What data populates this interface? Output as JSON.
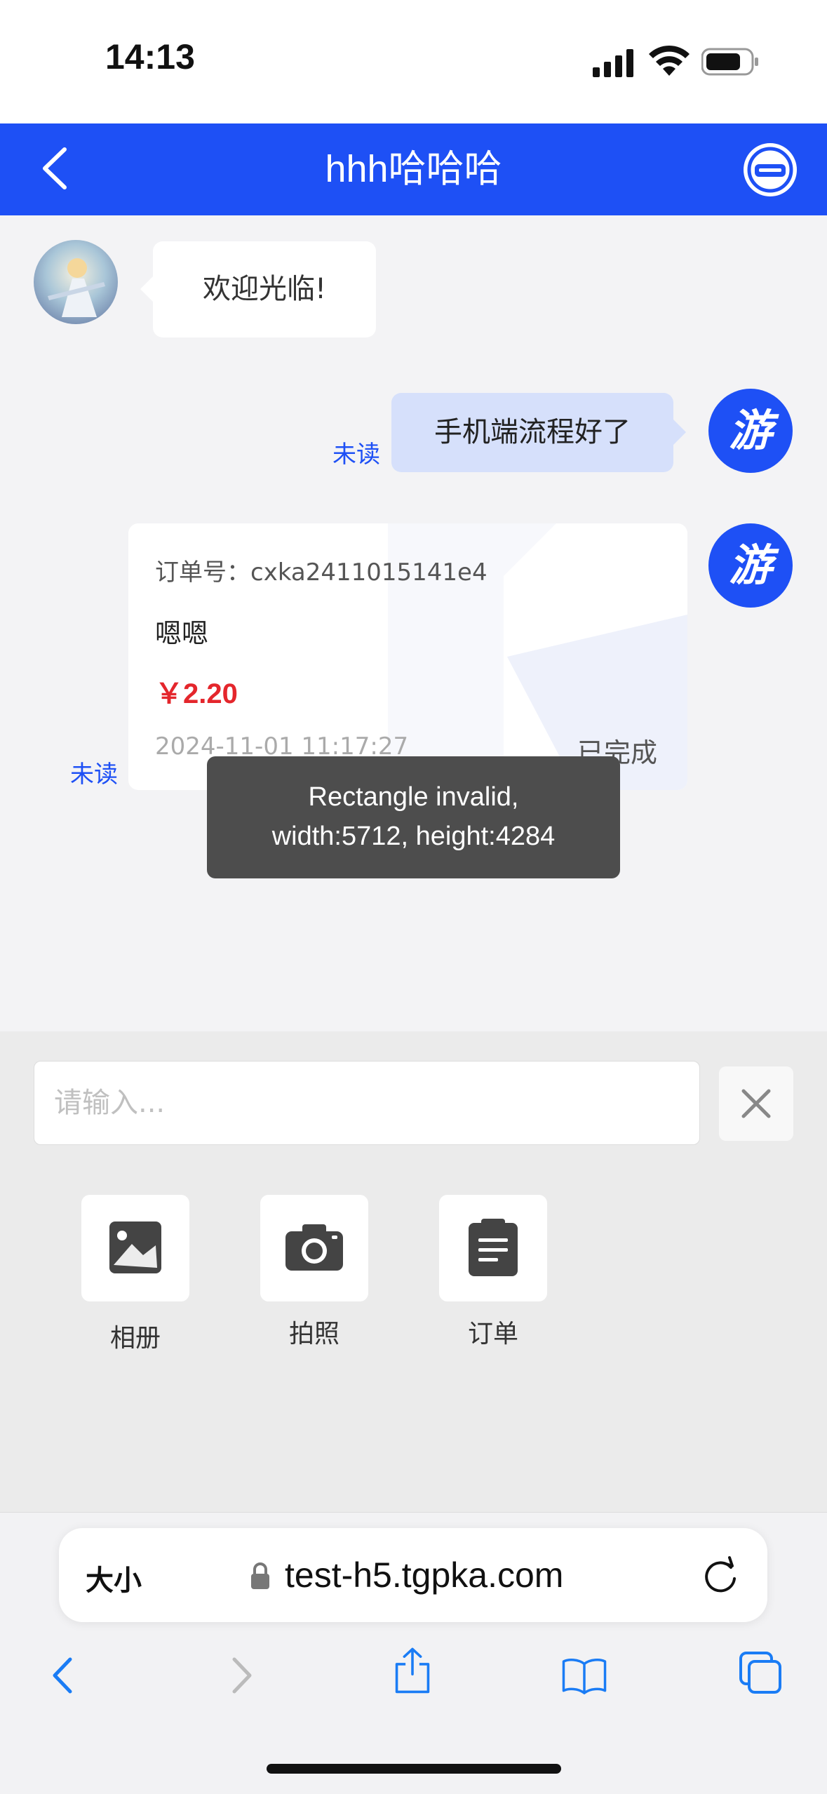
{
  "status_bar": {
    "time": "14:13"
  },
  "header": {
    "title": "hhh哈哈哈"
  },
  "chat": {
    "welcome_message": "欢迎光临!",
    "user_message": "手机端流程好了",
    "unread_label_1": "未读",
    "unread_label_2": "未读",
    "user_avatar_text": "游",
    "order": {
      "order_no": "订单号：cxka2411015141e4",
      "name": "嗯嗯",
      "price": "￥2.20",
      "time": "2024-11-01 11:17:27",
      "status": "已完成"
    },
    "toast_line1": "Rectangle invalid,",
    "toast_line2": "width:5712, height:4284"
  },
  "input": {
    "placeholder": "请输入..."
  },
  "tools": [
    {
      "label": "相册",
      "icon": "image-icon"
    },
    {
      "label": "拍照",
      "icon": "camera-icon"
    },
    {
      "label": "订单",
      "icon": "clipboard-icon"
    }
  ],
  "browser": {
    "text_size_label": "大小",
    "url": "test-h5.tgpka.com"
  },
  "colors": {
    "brand_blue": "#1e50f5",
    "price_red": "#e4262c",
    "bubble_right": "#d6e0fb"
  }
}
